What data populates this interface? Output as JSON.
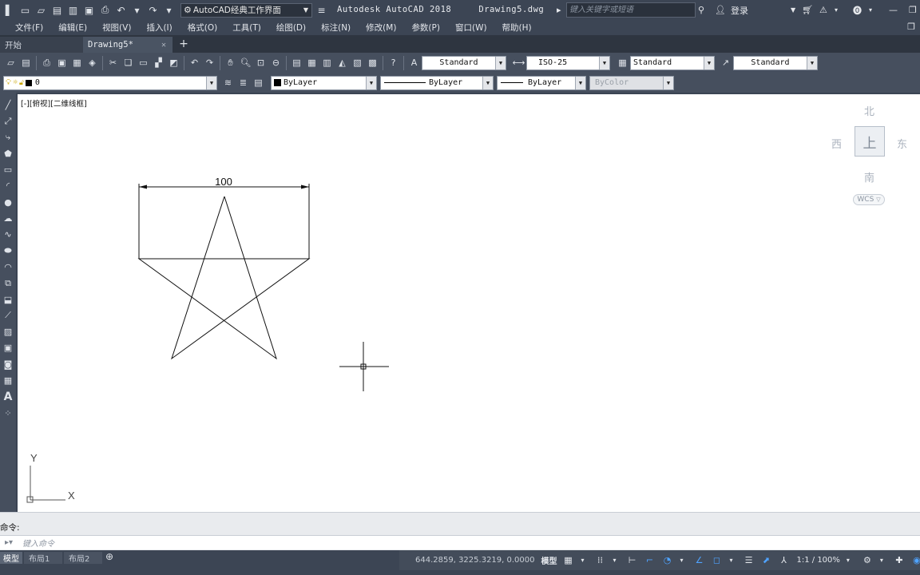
{
  "title_bar": {
    "workspace": "AutoCAD经典工作界面",
    "app_title": "Autodesk AutoCAD 2018",
    "drawing_name": "Drawing5.dwg",
    "search_placeholder": "键入关键字或短语",
    "login_label": "登录"
  },
  "menu": {
    "items": [
      "文件(F)",
      "编辑(E)",
      "视图(V)",
      "插入(I)",
      "格式(O)",
      "工具(T)",
      "绘图(D)",
      "标注(N)",
      "修改(M)",
      "参数(P)",
      "窗口(W)",
      "帮助(H)"
    ]
  },
  "file_tabs": {
    "start": "开始",
    "active": "Drawing5*"
  },
  "styles_toolbar": {
    "text_style": "Standard",
    "dim_style": "ISO-25",
    "table_style": "Standard",
    "mleader_style": "Standard"
  },
  "layers_toolbar": {
    "layer": "0",
    "color": "ByLayer",
    "linetype": "ByLayer",
    "lineweight": "ByLayer",
    "plot_style": "ByColor"
  },
  "canvas": {
    "view_label": "[-][俯视][二维线框]",
    "dimension_text": "100",
    "ucs_x": "X",
    "ucs_y": "Y"
  },
  "viewcube": {
    "north": "北",
    "south": "南",
    "east": "东",
    "west": "西",
    "face": "上",
    "wcs": "WCS"
  },
  "command": {
    "history": "命令:",
    "placeholder": "键入命令"
  },
  "layout_tabs": [
    "模型",
    "布局1",
    "布局2"
  ],
  "status": {
    "coordinates": "644.2859, 3225.3219, 0.0000",
    "space": "模型",
    "scale": "1:1 / 100%"
  }
}
